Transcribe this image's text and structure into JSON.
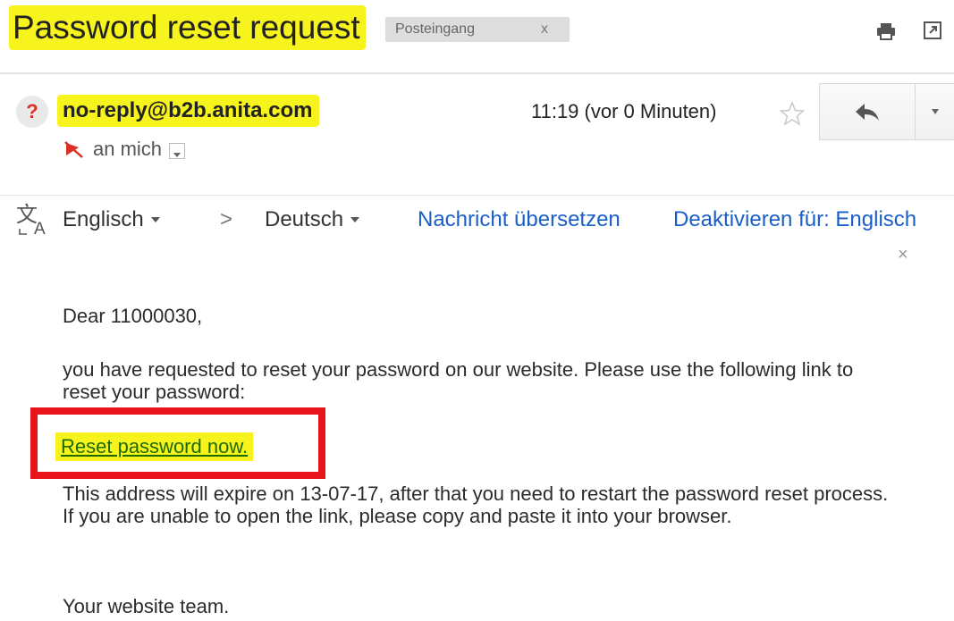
{
  "email": {
    "subject": "Password reset request",
    "label_chip": "Posteingang",
    "label_remove": "x",
    "sender": "no-reply@b2b.anita.com",
    "sender_avatar_glyph": "?",
    "timestamp": "11:19 (vor 0 Minuten)",
    "recipient": "an mich"
  },
  "translate_bar": {
    "source_language": "Englisch",
    "arrow": ">",
    "target_language": "Deutsch",
    "translate_link": "Nachricht übersetzen",
    "disable_link": "Deaktivieren für: Englisch",
    "close": "×"
  },
  "body": {
    "greeting": "Dear 11000030,",
    "paragraph1": "you have requested to reset your password on our website. Please use the following link to reset your password:",
    "reset_link": "Reset password now.",
    "paragraph2": "This address will expire on 13-07-17, after that you need to restart the password reset process. If you are unable to open the link, please copy and paste it into your browser.",
    "signoff": "Your website team."
  },
  "icons": {
    "print": "print-icon",
    "new_window": "new-window-icon",
    "star": "star-icon",
    "reply": "reply-icon",
    "more": "chevron-down-icon",
    "not_encrypted": "no-encryption-icon",
    "translate": "translate-icon"
  },
  "colors": {
    "highlight": "#f7f31c",
    "annotation_red": "#e8141b",
    "link_blue": "#1a5fc8",
    "reset_link_green": "#1d6a00",
    "avatar_question": "#d93025"
  }
}
